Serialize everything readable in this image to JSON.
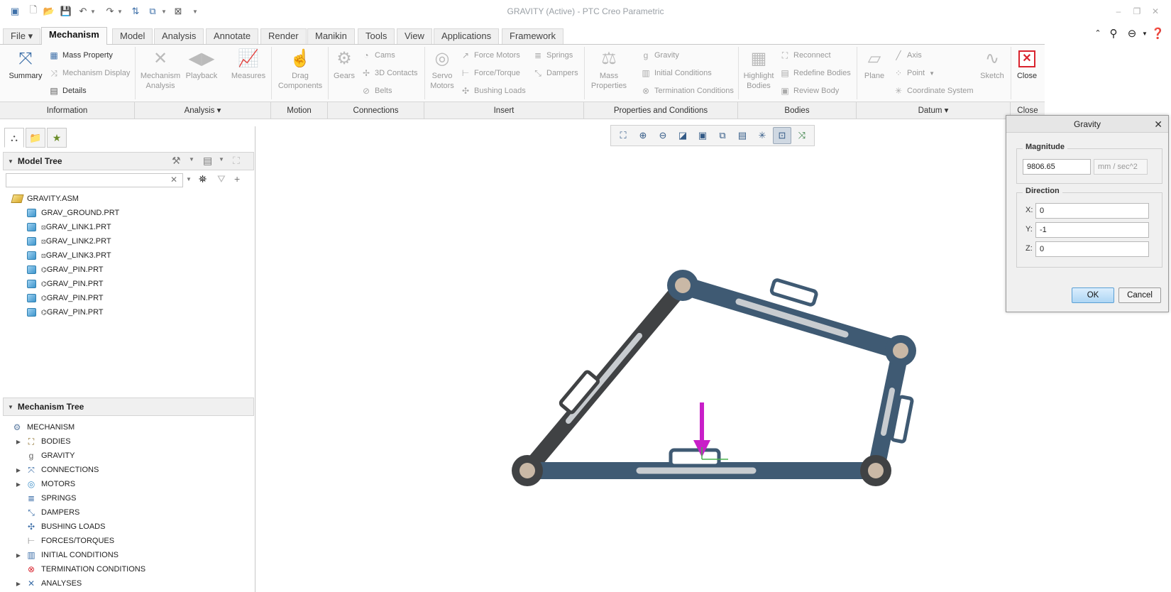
{
  "window": {
    "title": "GRAVITY (Active) - PTC Creo Parametric"
  },
  "ribbon": {
    "tabs": [
      "File",
      "Mechanism",
      "Model",
      "Analysis",
      "Annotate",
      "Render",
      "Manikin",
      "Tools",
      "View",
      "Applications",
      "Framework"
    ],
    "information": {
      "summary": "Summary",
      "mass_property": "Mass Property",
      "mechanism_display": "Mechanism Display",
      "details": "Details"
    },
    "analysis": {
      "mechanism_analysis": "Mechanism Analysis",
      "playback": "Playback",
      "measures": "Measures"
    },
    "motion": {
      "drag_components": "Drag Components"
    },
    "connections": {
      "gears": "Gears",
      "cams": "Cams",
      "contacts_3d": "3D Contacts",
      "belts": "Belts"
    },
    "insert": {
      "servo_motors": "Servo Motors",
      "force_motors": "Force Motors",
      "force_torque": "Force/Torque",
      "bushing_loads": "Bushing Loads",
      "springs": "Springs",
      "dampers": "Dampers"
    },
    "properties": {
      "mass_properties": "Mass Properties",
      "gravity": "Gravity",
      "initial_conditions": "Initial Conditions",
      "termination_conditions": "Termination Conditions"
    },
    "bodies": {
      "highlight_bodies": "Highlight Bodies",
      "reconnect": "Reconnect",
      "redefine_bodies": "Redefine Bodies",
      "review_body": "Review Body"
    },
    "datum": {
      "plane": "Plane",
      "axis": "Axis",
      "point": "Point",
      "coordinate_system": "Coordinate System",
      "sketch": "Sketch"
    },
    "close": {
      "close": "Close"
    },
    "groups": [
      "Information",
      "Analysis",
      "Motion",
      "Connections",
      "Insert",
      "Properties and Conditions",
      "Bodies",
      "Datum",
      "Close"
    ]
  },
  "model_tree": {
    "header": "Model Tree",
    "search_value": "",
    "items": [
      "GRAVITY.ASM",
      "GRAV_GROUND.PRT",
      "GRAV_LINK1.PRT",
      "GRAV_LINK2.PRT",
      "GRAV_LINK3.PRT",
      "GRAV_PIN.PRT",
      "GRAV_PIN.PRT",
      "GRAV_PIN.PRT",
      "GRAV_PIN.PRT"
    ]
  },
  "mechanism_tree": {
    "header": "Mechanism Tree",
    "items": [
      "MECHANISM",
      "BODIES",
      "GRAVITY",
      "CONNECTIONS",
      "MOTORS",
      "SPRINGS",
      "DAMPERS",
      "BUSHING LOADS",
      "FORCES/TORQUES",
      "INITIAL CONDITIONS",
      "TERMINATION CONDITIONS",
      "ANALYSES"
    ]
  },
  "gravity_dialog": {
    "title": "Gravity",
    "magnitude_label": "Magnitude",
    "magnitude_value": "9806.65",
    "units": "mm / sec^2",
    "direction_label": "Direction",
    "x_label": "X:",
    "x_value": "0",
    "y_label": "Y:",
    "y_value": "-1",
    "z_label": "Z:",
    "z_value": "0",
    "ok": "OK",
    "cancel": "Cancel"
  },
  "colors": {
    "accent": "#3d6fa8",
    "link_fill": "#3f5a73",
    "ground_link": "#404244",
    "gravity_arrow": "#c81fc8",
    "close_red": "#d9232e"
  }
}
